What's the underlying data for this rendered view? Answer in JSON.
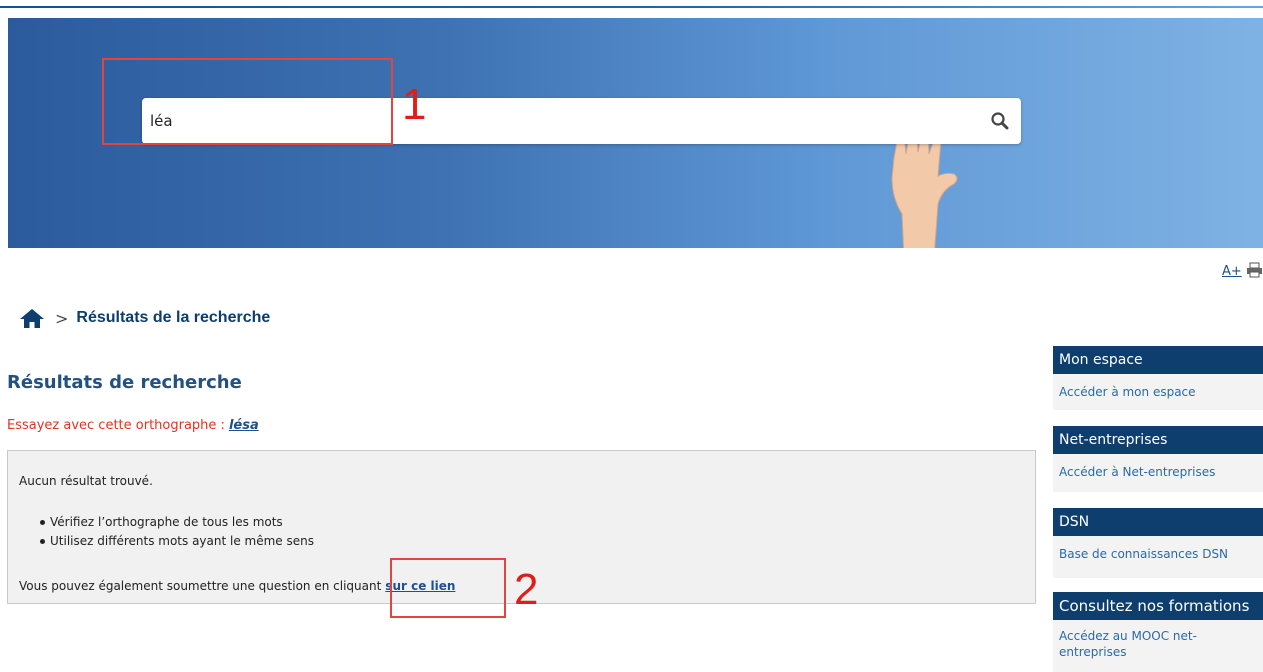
{
  "search": {
    "value": "léa"
  },
  "annotations": {
    "first": "1",
    "second": "2"
  },
  "tools": {
    "font_size_label": "A+"
  },
  "breadcrumb": {
    "separator": ">",
    "current": "Résultats de la recherche"
  },
  "page_title": "Résultats de recherche",
  "suggestion": {
    "prefix": "Essayez avec cette orthographe :",
    "link": "lésa"
  },
  "results": {
    "message": "Aucun résultat trouvé.",
    "tips": [
      "Vérifiez l’orthographe de tous les mots",
      "Utilisez différents mots ayant le même sens"
    ],
    "submit_prefix": "Vous pouvez également soumettre une question en cliquant",
    "submit_link": "sur ce lien"
  },
  "sidebar": {
    "cards": [
      {
        "title": "Mon espace",
        "link": "Accéder à mon espace"
      },
      {
        "title": "Net-entreprises",
        "link": "Accéder à Net-entreprises"
      },
      {
        "title": "DSN",
        "link": "Base de connaissances DSN"
      },
      {
        "title": "Consultez nos formations",
        "link": "Accédez au MOOC net-entreprises"
      }
    ]
  },
  "colors": {
    "banner_dark": "#2b5b9c",
    "banner_light": "#7fb2e4",
    "sidebar_head": "#0d3e6e",
    "annotation": "#e2453f",
    "suggestion": "#e2341f"
  },
  "icons": {
    "search": "magnifier-icon",
    "home": "home-icon",
    "print": "printer-icon"
  }
}
